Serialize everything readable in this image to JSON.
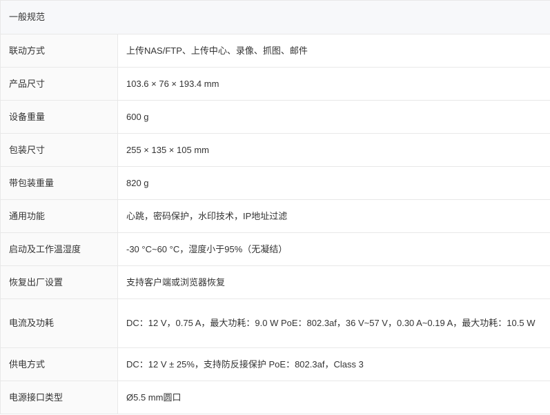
{
  "section": {
    "title": "一般规范"
  },
  "rows": [
    {
      "label": "联动方式",
      "value": "上传NAS/FTP、上传中心、录像、抓图、邮件"
    },
    {
      "label": "产品尺寸",
      "value": "103.6 × 76 × 193.4 mm"
    },
    {
      "label": "设备重量",
      "value": "600 g"
    },
    {
      "label": "包装尺寸",
      "value": "255 × 135 × 105 mm"
    },
    {
      "label": "带包装重量",
      "value": "820 g"
    },
    {
      "label": "通用功能",
      "value": "心跳，密码保护，水印技术，IP地址过滤"
    },
    {
      "label": "启动及工作温湿度",
      "value": "-30 °C~60 °C，湿度小于95%（无凝结）"
    },
    {
      "label": "恢复出厂设置",
      "value": "支持客户端或浏览器恢复"
    },
    {
      "label": "电流及功耗",
      "value": "DC：12 V，0.75 A，最大功耗：9.0 W PoE：802.3af，36 V~57 V，0.30 A~0.19 A，最大功耗：10.5 W"
    },
    {
      "label": "供电方式",
      "value": "DC：12 V ± 25%，支持防反接保护 PoE：802.3af，Class 3"
    },
    {
      "label": "电源接口类型",
      "value": "Ø5.5 mm圆口"
    }
  ]
}
